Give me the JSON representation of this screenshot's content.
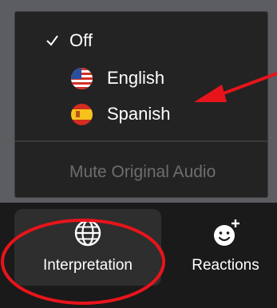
{
  "menu": {
    "items": [
      {
        "label": "Off",
        "checked": true
      },
      {
        "label": "English",
        "flag": "us-flag-icon"
      },
      {
        "label": "Spanish",
        "flag": "spain-flag-icon"
      }
    ],
    "mute_label": "Mute Original Audio"
  },
  "toolbar": {
    "interpretation_label": "Interpretation",
    "interpretation_icon": "globe-icon",
    "reactions_label": "Reactions",
    "reactions_icon": "add-emoji-icon"
  },
  "colors": {
    "menu_bg": "#232323",
    "toolbar_bg": "#1a1a1a",
    "active_button_bg": "#2e2e2e",
    "disabled_text": "#6e6e6e",
    "annotation": "#e8141b"
  }
}
